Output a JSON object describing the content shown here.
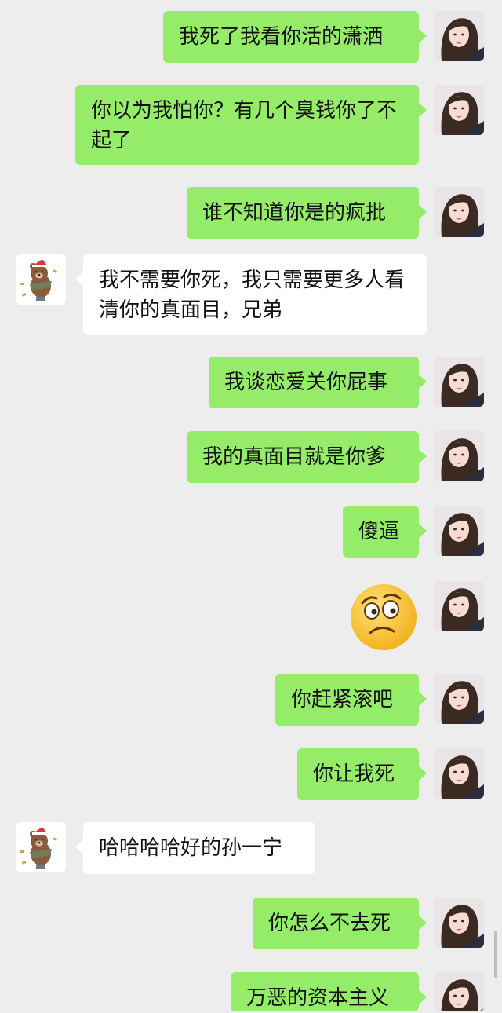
{
  "conversation": {
    "messages": [
      {
        "side": "me",
        "text": "我死了我看你活的潇洒"
      },
      {
        "side": "me",
        "text": "你以为我怕你？有几个臭钱你了不起了"
      },
      {
        "side": "me",
        "text": "谁不知道你是的疯批"
      },
      {
        "side": "other",
        "text": "我不需要你死，我只需要更多人看清你的真面目，兄弟"
      },
      {
        "side": "me",
        "text": "我谈恋爱关你屁事"
      },
      {
        "side": "me",
        "text": "我的真面目就是你爹"
      },
      {
        "side": "me",
        "text": "傻逼"
      },
      {
        "side": "me",
        "type": "emoji",
        "emoji": "worried-face-emoji"
      },
      {
        "side": "me",
        "text": "你赶紧滚吧"
      },
      {
        "side": "me",
        "text": "你让我死"
      },
      {
        "side": "other",
        "text": "哈哈哈哈好的孙一宁"
      },
      {
        "side": "me",
        "text": "你怎么不去死"
      },
      {
        "side": "me",
        "text": "万恶的资本主义"
      }
    ]
  },
  "colors": {
    "background": "#ededed",
    "my_bubble": "#95ec69",
    "other_bubble": "#ffffff"
  },
  "icons": {
    "my_avatar": "girl-portrait-avatar",
    "other_avatar": "brown-bear-santa-hat-avatar"
  }
}
